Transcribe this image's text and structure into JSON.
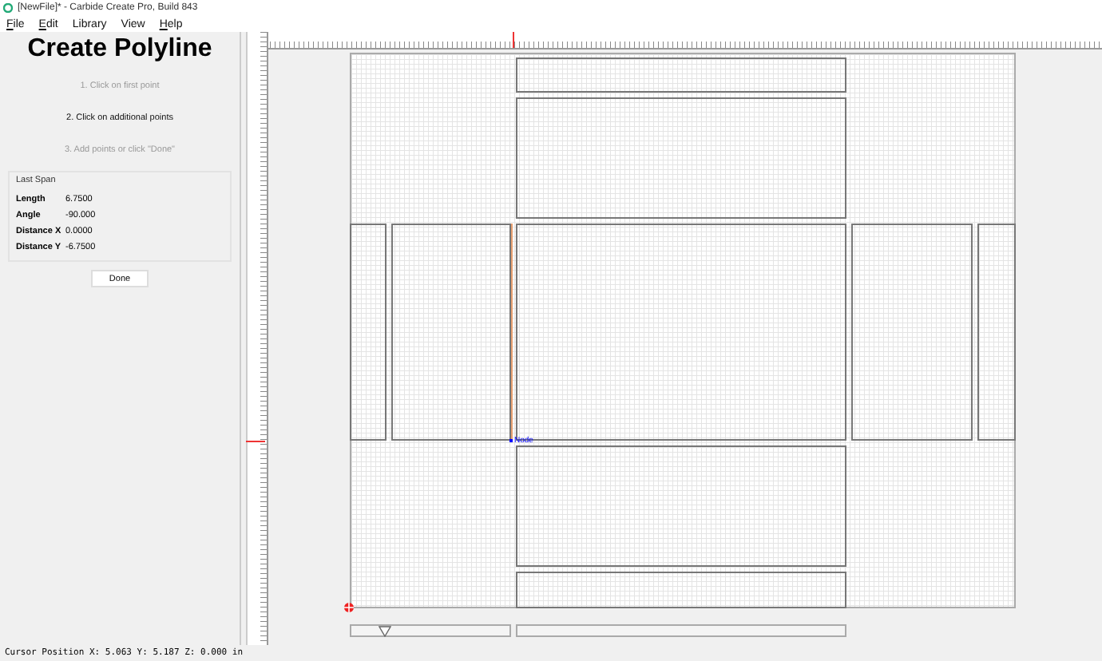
{
  "window": {
    "title": "[NewFile]* - Carbide Create Pro, Build 843"
  },
  "menu": [
    {
      "label": "File",
      "underlined": true
    },
    {
      "label": "Edit",
      "underlined": true
    },
    {
      "label": "Library",
      "underlined": false
    },
    {
      "label": "View",
      "underlined": false
    },
    {
      "label": "Help",
      "underlined": true
    }
  ],
  "panel": {
    "title": "Create Polyline",
    "steps": [
      {
        "label": "1. Click on first point",
        "selected": false
      },
      {
        "label": "2. Click on additional points",
        "selected": true
      },
      {
        "label": "3. Add points or click \"Done\"",
        "selected": false
      }
    ],
    "last_span": {
      "title": "Last Span",
      "rows": [
        {
          "label": "Length",
          "value": "6.7500"
        },
        {
          "label": "Angle",
          "value": "-90.000"
        },
        {
          "label": "Distance X",
          "value": "0.0000"
        },
        {
          "label": "Distance Y",
          "value": "-6.7500"
        }
      ]
    },
    "done_button": "Done"
  },
  "canvas": {
    "node_label": "Node"
  },
  "status_bar": "Cursor Position X: 5.063 Y: 5.187 Z: 0.000 in"
}
